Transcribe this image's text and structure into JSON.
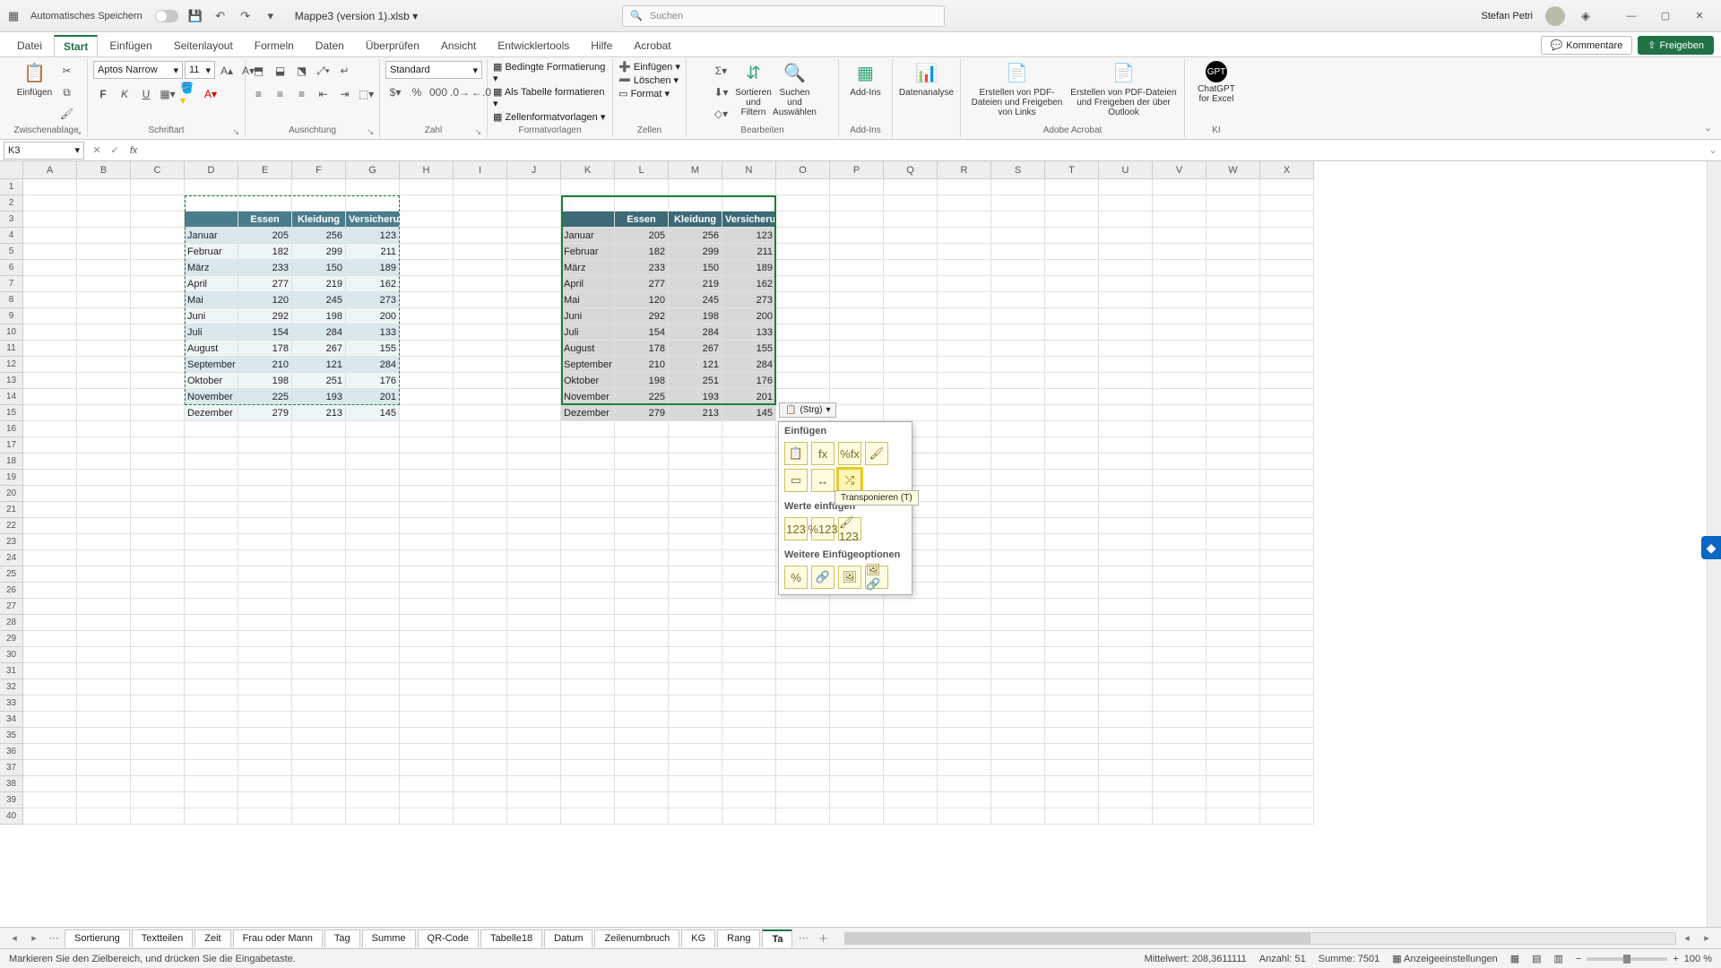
{
  "titlebar": {
    "autosave": "Automatisches Speichern",
    "filename": "Mappe3 (version 1).xlsb",
    "search_placeholder": "Suchen",
    "user": "Stefan Petri"
  },
  "menu": {
    "tabs": [
      "Datei",
      "Start",
      "Einfügen",
      "Seitenlayout",
      "Formeln",
      "Daten",
      "Überprüfen",
      "Ansicht",
      "Entwicklertools",
      "Hilfe",
      "Acrobat"
    ],
    "active": "Start",
    "comments": "Kommentare",
    "share": "Freigeben"
  },
  "ribbon": {
    "clipboard": {
      "paste": "Einfügen",
      "label": "Zwischenablage"
    },
    "font": {
      "name": "Aptos Narrow",
      "size": "11",
      "label": "Schriftart"
    },
    "align": {
      "label": "Ausrichtung"
    },
    "number": {
      "format": "Standard",
      "label": "Zahl"
    },
    "styles": {
      "cond": "Bedingte Formatierung",
      "table": "Als Tabelle formatieren",
      "cell": "Zellenformatvorlagen",
      "label": "Formatvorlagen"
    },
    "cells": {
      "ins": "Einfügen",
      "del": "Löschen",
      "fmt": "Format",
      "label": "Zellen"
    },
    "editing": {
      "sort": "Sortieren und Filtern",
      "find": "Suchen und Auswählen",
      "label": "Bearbeiten"
    },
    "addins": {
      "btn": "Add-Ins",
      "label": "Add-Ins"
    },
    "data": {
      "btn": "Datenanalyse"
    },
    "pdf1": "Erstellen von PDF-Dateien und Freigeben von Links",
    "pdf2": "Erstellen von PDF-Dateien und Freigeben der über Outlook",
    "adobe": "Adobe Acrobat",
    "gpt": {
      "btn": "ChatGPT for Excel",
      "label": "KI"
    }
  },
  "formula": {
    "cell": "K3"
  },
  "columns": [
    "A",
    "B",
    "C",
    "D",
    "E",
    "F",
    "G",
    "H",
    "I",
    "J",
    "K",
    "L",
    "M",
    "N",
    "O",
    "P",
    "Q",
    "R",
    "S",
    "T",
    "U",
    "V",
    "W",
    "X"
  ],
  "table": {
    "headers": [
      "",
      "Essen",
      "Kleidung",
      "Versicherung"
    ],
    "headers2_last": "Versicherun",
    "rows": [
      [
        "Januar",
        205,
        256,
        123
      ],
      [
        "Februar",
        182,
        299,
        211
      ],
      [
        "März",
        233,
        150,
        189
      ],
      [
        "April",
        277,
        219,
        162
      ],
      [
        "Mai",
        120,
        245,
        273
      ],
      [
        "Juni",
        292,
        198,
        200
      ],
      [
        "Juli",
        154,
        284,
        133
      ],
      [
        "August",
        178,
        267,
        155
      ],
      [
        "September",
        210,
        121,
        284
      ],
      [
        "Oktober",
        198,
        251,
        176
      ],
      [
        "November",
        225,
        193,
        201
      ],
      [
        "Dezember",
        279,
        213,
        145
      ]
    ]
  },
  "paste": {
    "tag": "(Strg)",
    "h1": "Einfügen",
    "h2": "Werte einfügen",
    "h3": "Weitere Einfügeoptionen",
    "tooltip": "Transponieren (T)"
  },
  "sheets": {
    "tabs": [
      "Sortierung",
      "Textteilen",
      "Zeit",
      "Frau oder Mann",
      "Tag",
      "Summe",
      "QR-Code",
      "Tabelle18",
      "Datum",
      "Zeilenumbruch",
      "KG",
      "Rang",
      "Ta"
    ],
    "active_index": 12
  },
  "status": {
    "msg": "Markieren Sie den Zielbereich, und drücken Sie die Eingabetaste.",
    "avg_l": "Mittelwert:",
    "avg": "208,3611111",
    "cnt_l": "Anzahl:",
    "cnt": "51",
    "sum_l": "Summe:",
    "sum": "7501",
    "disp": "Anzeigeeinstellungen",
    "zoom": "100 %"
  }
}
